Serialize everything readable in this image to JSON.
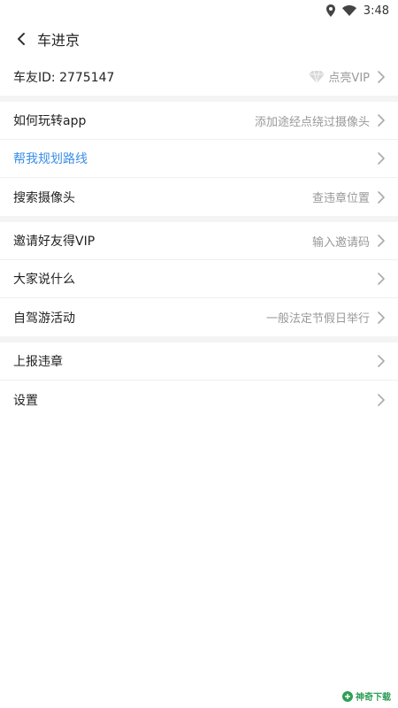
{
  "status_bar": {
    "time": "3:48"
  },
  "nav": {
    "title": "车进京"
  },
  "profile": {
    "label": "车友ID: 2775147",
    "vip_label": "点亮VIP"
  },
  "section1": [
    {
      "label": "如何玩转app",
      "hint": "添加途经点绕过摄像头"
    },
    {
      "label": "帮我规划路线",
      "hint": ""
    },
    {
      "label": "搜索摄像头",
      "hint": "查违章位置"
    }
  ],
  "section2": [
    {
      "label": "邀请好友得VIP",
      "hint": "输入邀请码"
    },
    {
      "label": "大家说什么",
      "hint": ""
    },
    {
      "label": "自驾游活动",
      "hint": "一般法定节假日举行"
    }
  ],
  "section3": [
    {
      "label": "上报违章",
      "hint": ""
    },
    {
      "label": "设置",
      "hint": ""
    }
  ],
  "watermark": {
    "text": "神奇下载"
  },
  "colors": {
    "link_blue": "#3a8ee6",
    "hint_gray": "#999999",
    "divider_gray": "#f4f4f4",
    "watermark_green": "#2f9e57"
  }
}
